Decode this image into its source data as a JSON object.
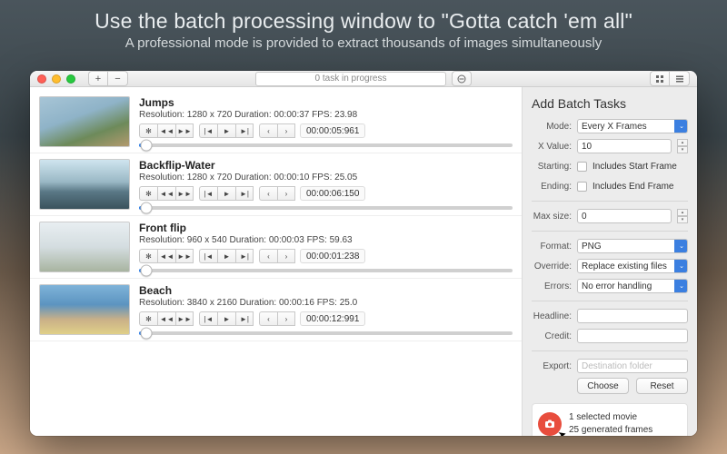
{
  "banner": {
    "title": "Use the batch processing window to \"Gotta catch 'em all\"",
    "subtitle": "A professional mode is provided to extract thousands of images simultaneously"
  },
  "toolbar": {
    "progress_text": "0 task in progress"
  },
  "items": [
    {
      "title": "Jumps",
      "resolution": "Resolution: 1280 x 720   Duration: 00:00:37   FPS: 23.98",
      "timecode": "00:00:05:961"
    },
    {
      "title": "Backflip-Water",
      "resolution": "Resolution: 1280 x 720   Duration: 00:00:10   FPS: 25.05",
      "timecode": "00:00:06:150"
    },
    {
      "title": "Front flip",
      "resolution": "Resolution: 960 x 540   Duration: 00:00:03   FPS: 59.63",
      "timecode": "00:00:01:238"
    },
    {
      "title": "Beach",
      "resolution": "Resolution: 3840 x 2160   Duration: 00:00:16   FPS: 25.0",
      "timecode": "00:00:12:991"
    }
  ],
  "sidebar": {
    "heading": "Add Batch Tasks",
    "mode_label": "Mode:",
    "mode_value": "Every X Frames",
    "xvalue_label": "X Value:",
    "xvalue": "10",
    "starting_label": "Starting:",
    "starting_check": "Includes Start Frame",
    "ending_label": "Ending:",
    "ending_check": "Includes End Frame",
    "maxsize_label": "Max size:",
    "maxsize": "0",
    "format_label": "Format:",
    "format_value": "PNG",
    "override_label": "Override:",
    "override_value": "Replace existing files",
    "errors_label": "Errors:",
    "errors_value": "No error handling",
    "headline_label": "Headline:",
    "credit_label": "Credit:",
    "export_label": "Export:",
    "export_placeholder": "Destination folder",
    "choose": "Choose",
    "reset": "Reset",
    "summary_line1": "1 selected movie",
    "summary_line2": "25 generated frames"
  }
}
